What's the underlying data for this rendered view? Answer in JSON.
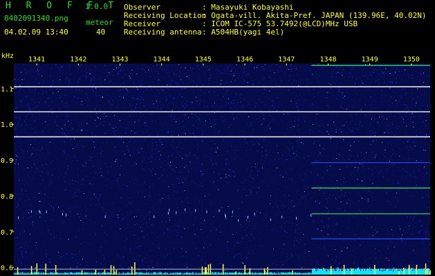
{
  "header": {
    "app_name": "H R O F F T",
    "version": "1.0.0",
    "filename": "0402091340.png",
    "datetime": "04.02.09 13:40",
    "meteor_label": "meteor",
    "meteor_count": "40",
    "info_labels": [
      "Observer",
      "Receiving Location",
      "Receiver",
      "Receiving antenna"
    ],
    "info_values": [
      ": Masayuki Kobayashi",
      ": Ogata-vill. Akita-Pref. JAPAN (139.96E, 40.02N)",
      ": ICOM IC-575 53.7492(@LCD)MHz USB",
      ": A504HB(yagi 4el)"
    ]
  },
  "colors": {
    "background": "#000000",
    "plot_background": "#060c4a",
    "header_text": "#28e028",
    "info_text": "#ffff30",
    "axis_text": "#ffff30",
    "line_strong": "#ffffff",
    "line_medium": "#40ff60",
    "line_weak": "#3050ff",
    "count_bars": "#00e8ff"
  },
  "chart_data": {
    "type": "heatmap",
    "ylabel": "kHz",
    "x_ticks": [
      "1341",
      "1342",
      "1343",
      "1344",
      "1345",
      "1346",
      "1347",
      "1348",
      "1349",
      "1350"
    ],
    "y_ticks": [
      "1.1",
      "1.0",
      "0.9",
      "0.8",
      "0.7",
      "0.6"
    ],
    "ylim": [
      0.58,
      1.17
    ],
    "xlim": [
      1340.45,
      1350.45
    ],
    "grid": false,
    "horizontal_lines_khz": [
      {
        "khz": 1.165,
        "strength": "medium",
        "x_start": 1347.6
      },
      {
        "khz": 1.105,
        "strength": "strong",
        "x_start": 1340.45
      },
      {
        "khz": 1.035,
        "strength": "strong",
        "x_start": 1340.45
      },
      {
        "khz": 0.965,
        "strength": "strong",
        "x_start": 1340.45
      },
      {
        "khz": 0.893,
        "strength": "weak",
        "x_start": 1347.6
      },
      {
        "khz": 0.822,
        "strength": "medium",
        "x_start": 1347.6
      },
      {
        "khz": 0.75,
        "strength": "medium",
        "x_start": 1347.6
      },
      {
        "khz": 0.68,
        "strength": "weak",
        "x_start": 1347.6
      }
    ],
    "noise_level_change_at": 1347.6
  }
}
